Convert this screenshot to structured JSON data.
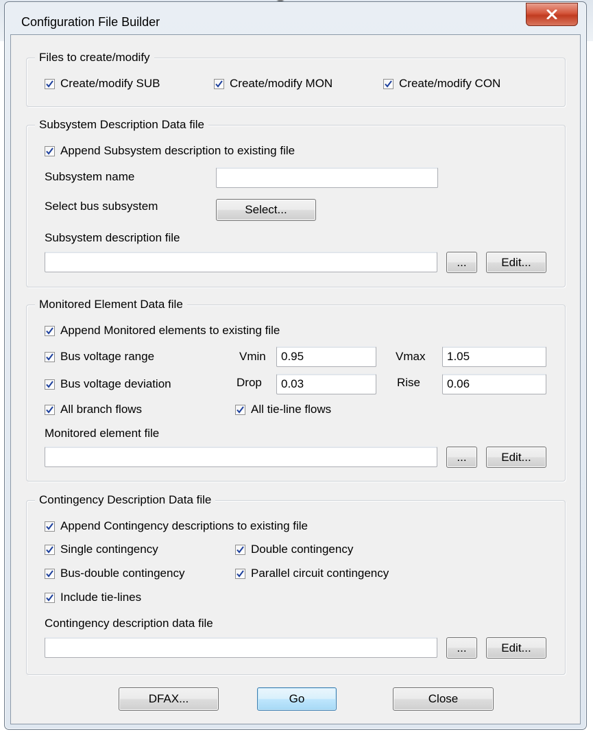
{
  "window": {
    "title": "Configuration File Builder"
  },
  "files_group": {
    "legend": "Files to create/modify",
    "sub": "Create/modify SUB",
    "mon": "Create/modify MON",
    "con": "Create/modify CON"
  },
  "sub_group": {
    "legend": "Subsystem Description Data file",
    "append": "Append Subsystem description to existing file",
    "name_label": "Subsystem name",
    "name_value": "",
    "select_label": "Select bus subsystem",
    "select_button": "Select...",
    "file_label": "Subsystem description file",
    "file_value": "",
    "browse": "...",
    "edit": "Edit..."
  },
  "mon_group": {
    "legend": "Monitored Element Data file",
    "append": "Append Monitored elements to existing file",
    "bus_range": "Bus voltage range",
    "vmin_label": "Vmin",
    "vmin_value": "0.95",
    "vmax_label": "Vmax",
    "vmax_value": "1.05",
    "bus_deviation": "Bus voltage deviation",
    "drop_label": "Drop",
    "drop_value": "0.03",
    "rise_label": "Rise",
    "rise_value": "0.06",
    "branch_flows": "All branch flows",
    "tie_line_flows": "All tie-line flows",
    "file_label": "Monitored element file",
    "file_value": "",
    "browse": "...",
    "edit": "Edit..."
  },
  "con_group": {
    "legend": "Contingency Description Data file",
    "append": "Append Contingency descriptions to existing file",
    "single": "Single contingency",
    "double": "Double contingency",
    "bus_double": "Bus-double contingency",
    "parallel": "Parallel circuit contingency",
    "tie_lines": "Include tie-lines",
    "file_label": "Contingency description data file",
    "file_value": "",
    "browse": "...",
    "edit": "Edit..."
  },
  "buttons": {
    "dfax": "DFAX...",
    "go": "Go",
    "close": "Close"
  },
  "colors": {
    "check": "#1c3f9c",
    "close_button": "#c8452a",
    "default_border": "#3c7fb1"
  }
}
